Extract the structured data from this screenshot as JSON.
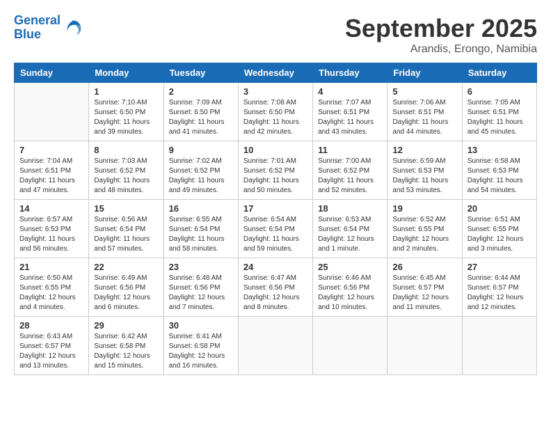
{
  "header": {
    "logo_line1": "General",
    "logo_line2": "Blue",
    "month_title": "September 2025",
    "location": "Arandis, Erongo, Namibia"
  },
  "weekdays": [
    "Sunday",
    "Monday",
    "Tuesday",
    "Wednesday",
    "Thursday",
    "Friday",
    "Saturday"
  ],
  "weeks": [
    [
      {
        "day": null
      },
      {
        "day": 1,
        "sunrise": "7:10 AM",
        "sunset": "6:50 PM",
        "daylight": "11 hours and 39 minutes."
      },
      {
        "day": 2,
        "sunrise": "7:09 AM",
        "sunset": "6:50 PM",
        "daylight": "11 hours and 41 minutes."
      },
      {
        "day": 3,
        "sunrise": "7:08 AM",
        "sunset": "6:50 PM",
        "daylight": "11 hours and 42 minutes."
      },
      {
        "day": 4,
        "sunrise": "7:07 AM",
        "sunset": "6:51 PM",
        "daylight": "11 hours and 43 minutes."
      },
      {
        "day": 5,
        "sunrise": "7:06 AM",
        "sunset": "6:51 PM",
        "daylight": "11 hours and 44 minutes."
      },
      {
        "day": 6,
        "sunrise": "7:05 AM",
        "sunset": "6:51 PM",
        "daylight": "11 hours and 45 minutes."
      }
    ],
    [
      {
        "day": 7,
        "sunrise": "7:04 AM",
        "sunset": "6:51 PM",
        "daylight": "11 hours and 47 minutes."
      },
      {
        "day": 8,
        "sunrise": "7:03 AM",
        "sunset": "6:52 PM",
        "daylight": "11 hours and 48 minutes."
      },
      {
        "day": 9,
        "sunrise": "7:02 AM",
        "sunset": "6:52 PM",
        "daylight": "11 hours and 49 minutes."
      },
      {
        "day": 10,
        "sunrise": "7:01 AM",
        "sunset": "6:52 PM",
        "daylight": "11 hours and 50 minutes."
      },
      {
        "day": 11,
        "sunrise": "7:00 AM",
        "sunset": "6:52 PM",
        "daylight": "11 hours and 52 minutes."
      },
      {
        "day": 12,
        "sunrise": "6:59 AM",
        "sunset": "6:53 PM",
        "daylight": "11 hours and 53 minutes."
      },
      {
        "day": 13,
        "sunrise": "6:58 AM",
        "sunset": "6:53 PM",
        "daylight": "11 hours and 54 minutes."
      }
    ],
    [
      {
        "day": 14,
        "sunrise": "6:57 AM",
        "sunset": "6:53 PM",
        "daylight": "11 hours and 56 minutes."
      },
      {
        "day": 15,
        "sunrise": "6:56 AM",
        "sunset": "6:54 PM",
        "daylight": "11 hours and 57 minutes."
      },
      {
        "day": 16,
        "sunrise": "6:55 AM",
        "sunset": "6:54 PM",
        "daylight": "11 hours and 58 minutes."
      },
      {
        "day": 17,
        "sunrise": "6:54 AM",
        "sunset": "6:54 PM",
        "daylight": "11 hours and 59 minutes."
      },
      {
        "day": 18,
        "sunrise": "6:53 AM",
        "sunset": "6:54 PM",
        "daylight": "12 hours and 1 minute."
      },
      {
        "day": 19,
        "sunrise": "6:52 AM",
        "sunset": "6:55 PM",
        "daylight": "12 hours and 2 minutes."
      },
      {
        "day": 20,
        "sunrise": "6:51 AM",
        "sunset": "6:55 PM",
        "daylight": "12 hours and 3 minutes."
      }
    ],
    [
      {
        "day": 21,
        "sunrise": "6:50 AM",
        "sunset": "6:55 PM",
        "daylight": "12 hours and 4 minutes."
      },
      {
        "day": 22,
        "sunrise": "6:49 AM",
        "sunset": "6:56 PM",
        "daylight": "12 hours and 6 minutes."
      },
      {
        "day": 23,
        "sunrise": "6:48 AM",
        "sunset": "6:56 PM",
        "daylight": "12 hours and 7 minutes."
      },
      {
        "day": 24,
        "sunrise": "6:47 AM",
        "sunset": "6:56 PM",
        "daylight": "12 hours and 8 minutes."
      },
      {
        "day": 25,
        "sunrise": "6:46 AM",
        "sunset": "6:56 PM",
        "daylight": "12 hours and 10 minutes."
      },
      {
        "day": 26,
        "sunrise": "6:45 AM",
        "sunset": "6:57 PM",
        "daylight": "12 hours and 11 minutes."
      },
      {
        "day": 27,
        "sunrise": "6:44 AM",
        "sunset": "6:57 PM",
        "daylight": "12 hours and 12 minutes."
      }
    ],
    [
      {
        "day": 28,
        "sunrise": "6:43 AM",
        "sunset": "6:57 PM",
        "daylight": "12 hours and 13 minutes."
      },
      {
        "day": 29,
        "sunrise": "6:42 AM",
        "sunset": "6:58 PM",
        "daylight": "12 hours and 15 minutes."
      },
      {
        "day": 30,
        "sunrise": "6:41 AM",
        "sunset": "6:58 PM",
        "daylight": "12 hours and 16 minutes."
      },
      {
        "day": null
      },
      {
        "day": null
      },
      {
        "day": null
      },
      {
        "day": null
      }
    ]
  ]
}
